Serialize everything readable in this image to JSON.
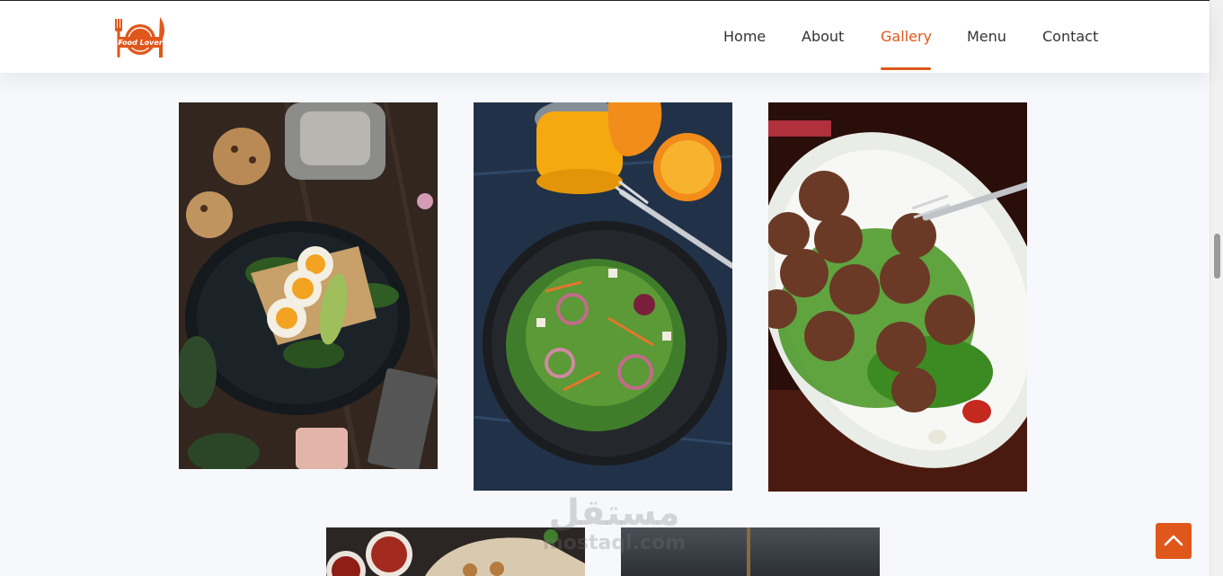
{
  "brand": {
    "logo_text": "Food Lover",
    "accent_color": "#e0571c"
  },
  "nav": {
    "items": [
      "Home",
      "About",
      "Gallery",
      "Menu",
      "Contact"
    ],
    "active": "Gallery"
  },
  "gallery": {
    "images": [
      {
        "name": "egg-avocado-toast-photo",
        "icon": "photo"
      },
      {
        "name": "salad-orange-juice-photo",
        "icon": "photo"
      },
      {
        "name": "meatballs-arugula-photo",
        "icon": "photo"
      },
      {
        "name": "dips-flatbread-photo",
        "icon": "photo"
      },
      {
        "name": "dark-dish-photo",
        "icon": "photo"
      }
    ]
  },
  "watermark": {
    "arabic": "مستقل",
    "latin": "mostaql.com"
  },
  "back_to_top": {
    "icon": "chevron-up-icon"
  }
}
